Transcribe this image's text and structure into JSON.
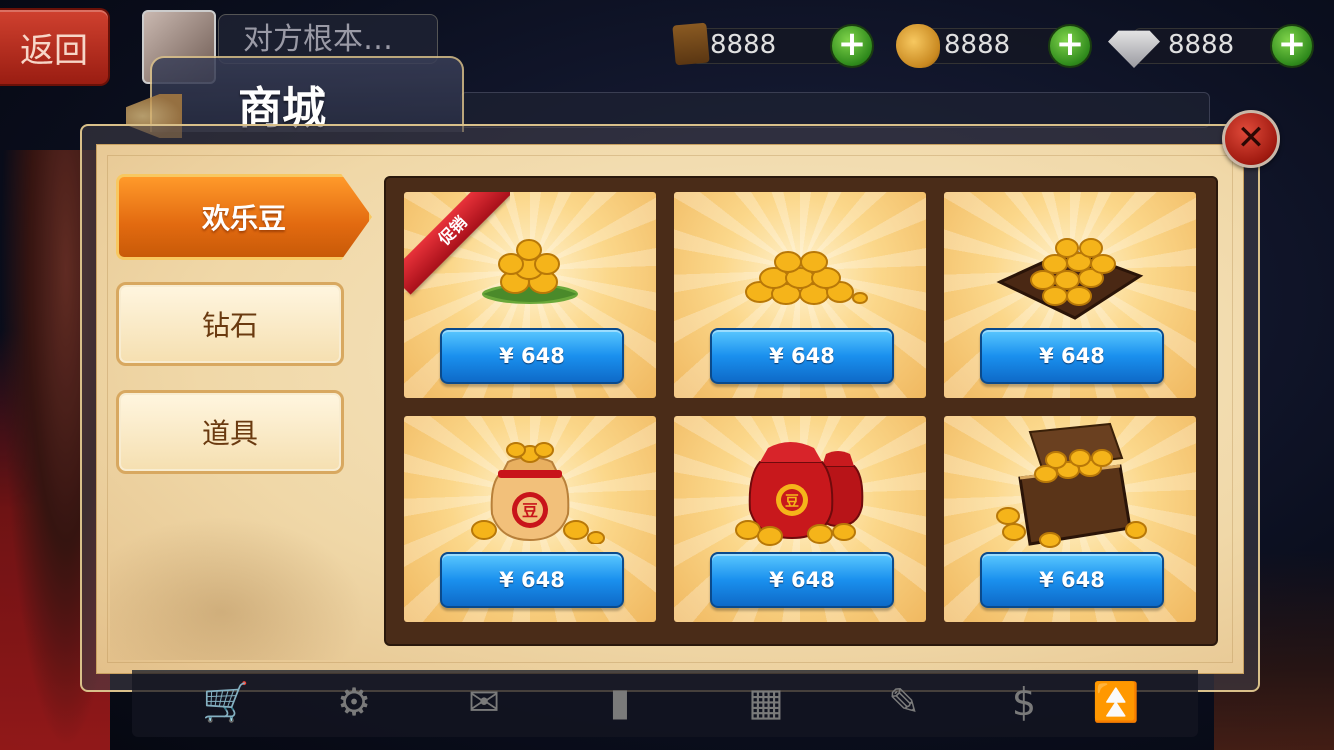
{
  "header": {
    "back_label": "返回",
    "player_name": "对方根本…",
    "resources": [
      {
        "icon": "scroll-icon",
        "value": "8888"
      },
      {
        "icon": "bean-icon",
        "value": "8888"
      },
      {
        "icon": "diamond-icon",
        "value": "8888"
      }
    ],
    "plus_label": "+"
  },
  "shop": {
    "title": "商城",
    "close_label": "✕",
    "tabs": [
      {
        "label": "欢乐豆",
        "active": true
      },
      {
        "label": "钻石",
        "active": false
      },
      {
        "label": "道具",
        "active": false
      }
    ],
    "promo_label": "促销",
    "items": [
      {
        "goods": "beans-on-leaf",
        "price": "¥ 648",
        "promo": true
      },
      {
        "goods": "bean-pile",
        "price": "¥ 648",
        "promo": false
      },
      {
        "goods": "bean-tray",
        "price": "¥ 648",
        "promo": false
      },
      {
        "goods": "bean-sack",
        "price": "¥ 648",
        "promo": false
      },
      {
        "goods": "bean-bags",
        "price": "¥ 648",
        "promo": false
      },
      {
        "goods": "treasure-chest",
        "price": "¥ 648",
        "promo": false
      }
    ]
  },
  "toolbar": {
    "icons": [
      "cart-icon",
      "gear-icon",
      "mail-icon",
      "rank-icon",
      "gift-icon",
      "task-icon",
      "money-bag-icon",
      "up-icon"
    ]
  },
  "colors": {
    "active_tab": "#e26a10",
    "price_button": "#1a90ee",
    "panel_bg": "#f0d8a8",
    "close": "#a01a10"
  }
}
